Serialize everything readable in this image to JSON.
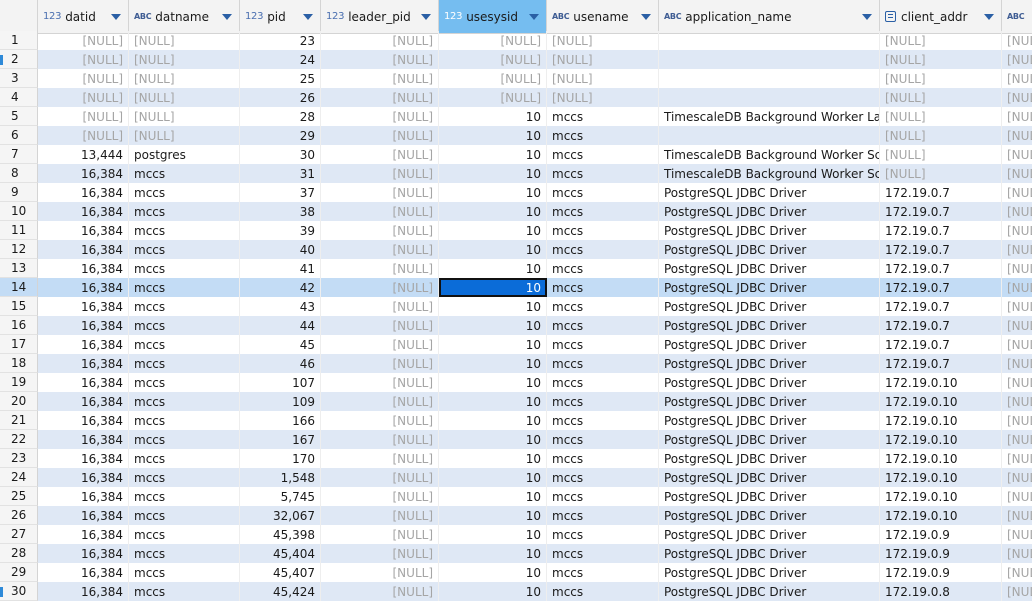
{
  "columns": [
    {
      "type": "123",
      "name": "datid"
    },
    {
      "type": "ABC",
      "name": "datname"
    },
    {
      "type": "123",
      "name": "pid"
    },
    {
      "type": "123",
      "name": "leader_pid"
    },
    {
      "type": "123",
      "name": "usesysid"
    },
    {
      "type": "ABC",
      "name": "usename"
    },
    {
      "type": "ABC",
      "name": "application_name"
    },
    {
      "type": "addr",
      "name": "client_addr"
    },
    {
      "type": "ABC",
      "name": ""
    }
  ],
  "selected_row": 14,
  "focused_cell": {
    "row": 14,
    "column": "usesysid"
  },
  "rows": [
    {
      "n": "1",
      "datid": "[NULL]",
      "datname": "[NULL]",
      "pid": "23",
      "leader_pid": "[NULL]",
      "usesysid": "[NULL]",
      "usename": "[NULL]",
      "application_name": "",
      "client_addr": "[NULL]",
      "extra": "[NULL]"
    },
    {
      "n": "2",
      "datid": "[NULL]",
      "datname": "[NULL]",
      "pid": "24",
      "leader_pid": "[NULL]",
      "usesysid": "[NULL]",
      "usename": "[NULL]",
      "application_name": "",
      "client_addr": "[NULL]",
      "extra": "[NULL]"
    },
    {
      "n": "3",
      "datid": "[NULL]",
      "datname": "[NULL]",
      "pid": "25",
      "leader_pid": "[NULL]",
      "usesysid": "[NULL]",
      "usename": "[NULL]",
      "application_name": "",
      "client_addr": "[NULL]",
      "extra": "[NULL]"
    },
    {
      "n": "4",
      "datid": "[NULL]",
      "datname": "[NULL]",
      "pid": "26",
      "leader_pid": "[NULL]",
      "usesysid": "[NULL]",
      "usename": "[NULL]",
      "application_name": "",
      "client_addr": "[NULL]",
      "extra": "[NULL]"
    },
    {
      "n": "5",
      "datid": "[NULL]",
      "datname": "[NULL]",
      "pid": "28",
      "leader_pid": "[NULL]",
      "usesysid": "10",
      "usename": "mccs",
      "application_name": "TimescaleDB Background Worker Launc",
      "client_addr": "[NULL]",
      "extra": "[NULL]"
    },
    {
      "n": "6",
      "datid": "[NULL]",
      "datname": "[NULL]",
      "pid": "29",
      "leader_pid": "[NULL]",
      "usesysid": "10",
      "usename": "mccs",
      "application_name": "",
      "client_addr": "[NULL]",
      "extra": "[NULL]"
    },
    {
      "n": "7",
      "datid": "13,444",
      "datname": "postgres",
      "pid": "30",
      "leader_pid": "[NULL]",
      "usesysid": "10",
      "usename": "mccs",
      "application_name": "TimescaleDB Background Worker Sched",
      "client_addr": "[NULL]",
      "extra": "[NUL"
    },
    {
      "n": "8",
      "datid": "16,384",
      "datname": "mccs",
      "pid": "31",
      "leader_pid": "[NULL]",
      "usesysid": "10",
      "usename": "mccs",
      "application_name": "TimescaleDB Background Worker Sched",
      "client_addr": "[NULL]",
      "extra": "[NUL"
    },
    {
      "n": "9",
      "datid": "16,384",
      "datname": "mccs",
      "pid": "37",
      "leader_pid": "[NULL]",
      "usesysid": "10",
      "usename": "mccs",
      "application_name": "PostgreSQL JDBC Driver",
      "client_addr": "172.19.0.7",
      "extra": "[NUL"
    },
    {
      "n": "10",
      "datid": "16,384",
      "datname": "mccs",
      "pid": "38",
      "leader_pid": "[NULL]",
      "usesysid": "10",
      "usename": "mccs",
      "application_name": "PostgreSQL JDBC Driver",
      "client_addr": "172.19.0.7",
      "extra": "[NUL"
    },
    {
      "n": "11",
      "datid": "16,384",
      "datname": "mccs",
      "pid": "39",
      "leader_pid": "[NULL]",
      "usesysid": "10",
      "usename": "mccs",
      "application_name": "PostgreSQL JDBC Driver",
      "client_addr": "172.19.0.7",
      "extra": "[NUL"
    },
    {
      "n": "12",
      "datid": "16,384",
      "datname": "mccs",
      "pid": "40",
      "leader_pid": "[NULL]",
      "usesysid": "10",
      "usename": "mccs",
      "application_name": "PostgreSQL JDBC Driver",
      "client_addr": "172.19.0.7",
      "extra": "[NUL"
    },
    {
      "n": "13",
      "datid": "16,384",
      "datname": "mccs",
      "pid": "41",
      "leader_pid": "[NULL]",
      "usesysid": "10",
      "usename": "mccs",
      "application_name": "PostgreSQL JDBC Driver",
      "client_addr": "172.19.0.7",
      "extra": "[NUL"
    },
    {
      "n": "14",
      "datid": "16,384",
      "datname": "mccs",
      "pid": "42",
      "leader_pid": "[NULL]",
      "usesysid": "10",
      "usename": "mccs",
      "application_name": "PostgreSQL JDBC Driver",
      "client_addr": "172.19.0.7",
      "extra": "[NUL"
    },
    {
      "n": "15",
      "datid": "16,384",
      "datname": "mccs",
      "pid": "43",
      "leader_pid": "[NULL]",
      "usesysid": "10",
      "usename": "mccs",
      "application_name": "PostgreSQL JDBC Driver",
      "client_addr": "172.19.0.7",
      "extra": "[NUL"
    },
    {
      "n": "16",
      "datid": "16,384",
      "datname": "mccs",
      "pid": "44",
      "leader_pid": "[NULL]",
      "usesysid": "10",
      "usename": "mccs",
      "application_name": "PostgreSQL JDBC Driver",
      "client_addr": "172.19.0.7",
      "extra": "[NUL"
    },
    {
      "n": "17",
      "datid": "16,384",
      "datname": "mccs",
      "pid": "45",
      "leader_pid": "[NULL]",
      "usesysid": "10",
      "usename": "mccs",
      "application_name": "PostgreSQL JDBC Driver",
      "client_addr": "172.19.0.7",
      "extra": "[NUL"
    },
    {
      "n": "18",
      "datid": "16,384",
      "datname": "mccs",
      "pid": "46",
      "leader_pid": "[NULL]",
      "usesysid": "10",
      "usename": "mccs",
      "application_name": "PostgreSQL JDBC Driver",
      "client_addr": "172.19.0.7",
      "extra": "[NUL"
    },
    {
      "n": "19",
      "datid": "16,384",
      "datname": "mccs",
      "pid": "107",
      "leader_pid": "[NULL]",
      "usesysid": "10",
      "usename": "mccs",
      "application_name": "PostgreSQL JDBC Driver",
      "client_addr": "172.19.0.10",
      "extra": "[NUL"
    },
    {
      "n": "20",
      "datid": "16,384",
      "datname": "mccs",
      "pid": "109",
      "leader_pid": "[NULL]",
      "usesysid": "10",
      "usename": "mccs",
      "application_name": "PostgreSQL JDBC Driver",
      "client_addr": "172.19.0.10",
      "extra": "[NUL"
    },
    {
      "n": "21",
      "datid": "16,384",
      "datname": "mccs",
      "pid": "166",
      "leader_pid": "[NULL]",
      "usesysid": "10",
      "usename": "mccs",
      "application_name": "PostgreSQL JDBC Driver",
      "client_addr": "172.19.0.10",
      "extra": "[NUL"
    },
    {
      "n": "22",
      "datid": "16,384",
      "datname": "mccs",
      "pid": "167",
      "leader_pid": "[NULL]",
      "usesysid": "10",
      "usename": "mccs",
      "application_name": "PostgreSQL JDBC Driver",
      "client_addr": "172.19.0.10",
      "extra": "[NUL"
    },
    {
      "n": "23",
      "datid": "16,384",
      "datname": "mccs",
      "pid": "170",
      "leader_pid": "[NULL]",
      "usesysid": "10",
      "usename": "mccs",
      "application_name": "PostgreSQL JDBC Driver",
      "client_addr": "172.19.0.10",
      "extra": "[NUL"
    },
    {
      "n": "24",
      "datid": "16,384",
      "datname": "mccs",
      "pid": "1,548",
      "leader_pid": "[NULL]",
      "usesysid": "10",
      "usename": "mccs",
      "application_name": "PostgreSQL JDBC Driver",
      "client_addr": "172.19.0.10",
      "extra": "[NUL"
    },
    {
      "n": "25",
      "datid": "16,384",
      "datname": "mccs",
      "pid": "5,745",
      "leader_pid": "[NULL]",
      "usesysid": "10",
      "usename": "mccs",
      "application_name": "PostgreSQL JDBC Driver",
      "client_addr": "172.19.0.10",
      "extra": "[NUL"
    },
    {
      "n": "26",
      "datid": "16,384",
      "datname": "mccs",
      "pid": "32,067",
      "leader_pid": "[NULL]",
      "usesysid": "10",
      "usename": "mccs",
      "application_name": "PostgreSQL JDBC Driver",
      "client_addr": "172.19.0.10",
      "extra": "[NUL"
    },
    {
      "n": "27",
      "datid": "16,384",
      "datname": "mccs",
      "pid": "45,398",
      "leader_pid": "[NULL]",
      "usesysid": "10",
      "usename": "mccs",
      "application_name": "PostgreSQL JDBC Driver",
      "client_addr": "172.19.0.9",
      "extra": "[NUL"
    },
    {
      "n": "28",
      "datid": "16,384",
      "datname": "mccs",
      "pid": "45,404",
      "leader_pid": "[NULL]",
      "usesysid": "10",
      "usename": "mccs",
      "application_name": "PostgreSQL JDBC Driver",
      "client_addr": "172.19.0.9",
      "extra": "[NUL"
    },
    {
      "n": "29",
      "datid": "16,384",
      "datname": "mccs",
      "pid": "45,407",
      "leader_pid": "[NULL]",
      "usesysid": "10",
      "usename": "mccs",
      "application_name": "PostgreSQL JDBC Driver",
      "client_addr": "172.19.0.9",
      "extra": "[NUL"
    },
    {
      "n": "30",
      "datid": "16,384",
      "datname": "mccs",
      "pid": "45,424",
      "leader_pid": "[NULL]",
      "usesysid": "10",
      "usename": "mccs",
      "application_name": "PostgreSQL JDBC Driver",
      "client_addr": "172.19.0.8",
      "extra": "[NUL"
    }
  ]
}
